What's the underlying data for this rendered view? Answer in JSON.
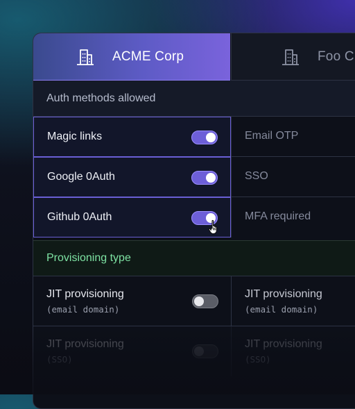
{
  "tabs": [
    {
      "label": "ACME Corp",
      "icon": "building-icon",
      "active": true
    },
    {
      "label": "Foo C",
      "icon": "building-icon",
      "active": false
    }
  ],
  "auth_section": {
    "title": "Auth methods allowed",
    "left": [
      {
        "label": "Magic links",
        "enabled": true
      },
      {
        "label": "Google 0Auth",
        "enabled": true
      },
      {
        "label": "Github 0Auth",
        "enabled": true
      }
    ],
    "right": [
      {
        "label": "Email OTP"
      },
      {
        "label": "SSO"
      },
      {
        "label": "MFA required"
      }
    ]
  },
  "provisioning_section": {
    "title": "Provisioning type",
    "rows": [
      {
        "left": {
          "label": "JIT provisioning",
          "sub": "(email domain)",
          "enabled": false
        },
        "right": {
          "label": "JIT provisioning",
          "sub": "(email domain)"
        }
      },
      {
        "left": {
          "label": "JIT provisioning",
          "sub": "(SSO)",
          "enabled": false
        },
        "right": {
          "label": "JIT provisioning",
          "sub": "(SSO)"
        }
      }
    ]
  },
  "colors": {
    "accent": "#6d5fd8",
    "success_text": "#7ee3a3"
  }
}
